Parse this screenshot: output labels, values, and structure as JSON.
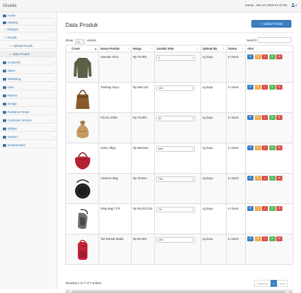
{
  "app": {
    "brand": "Gisella",
    "datetime": "Kamis , Mei 23 2019 21:47:06"
  },
  "sidebar": [
    {
      "label": "Home",
      "level": 1,
      "arrow": ""
    },
    {
      "label": "Katalog",
      "level": 1,
      "arrow": "⌄"
    },
    {
      "label": "Kategori",
      "level": 2,
      "arrow": "‹"
    },
    {
      "label": "Produk",
      "level": 2,
      "arrow": "⌄"
    },
    {
      "label": "Upload Produk",
      "level": 3,
      "arrow": ""
    },
    {
      "label": "Data Produk",
      "level": 3,
      "arrow": ""
    },
    {
      "label": "Customer",
      "level": 1,
      "arrow": "‹"
    },
    {
      "label": "Sales",
      "level": 1,
      "arrow": "‹"
    },
    {
      "label": "Marketing",
      "level": 1,
      "arrow": "‹"
    },
    {
      "label": "User",
      "level": 1,
      "arrow": "‹"
    },
    {
      "label": "Partner",
      "level": 1,
      "arrow": "‹"
    },
    {
      "label": "Design",
      "level": 1,
      "arrow": "‹"
    },
    {
      "label": "Kontak & Pesan",
      "level": 1,
      "arrow": "‹"
    },
    {
      "label": "Customer Service",
      "level": 1,
      "arrow": "‹"
    },
    {
      "label": "Widget",
      "level": 1,
      "arrow": "‹"
    },
    {
      "label": "System",
      "level": 1,
      "arrow": "‹"
    },
    {
      "label": "Dokumentasi",
      "level": 1,
      "arrow": ""
    }
  ],
  "page": {
    "title": "Data Produk",
    "upload_button": "Upload Produk"
  },
  "table_controls": {
    "show_label": "Show",
    "entries_value": "10",
    "entries_label": "entries",
    "search_label": "Search:",
    "search_value": ""
  },
  "columns": [
    "Cover",
    "Nama Produk",
    "Harga",
    "Jumlah Stok",
    "Upload By",
    "Status",
    "Aksi"
  ],
  "rows": [
    {
      "name": "Sweater Ohio",
      "price": "Rp 78.000",
      "stock": "4",
      "upload_by": "ng bayu",
      "status": "In Stock",
      "cover": "sweater"
    },
    {
      "name": "Totebag Onyo",
      "price": "Rp 865.222",
      "stock": "100",
      "upload_by": "ng bayu",
      "status": "In Stock",
      "cover": "tote"
    },
    {
      "name": "Pouch Jelliot",
      "price": "Rp 78.000",
      "stock": "90",
      "upload_by": "ng bayu",
      "status": "In Stock",
      "cover": "pouch"
    },
    {
      "name": "Hobo Ulbyy",
      "price": "Rp 666.664",
      "stock": "666",
      "upload_by": "ng bayu",
      "status": "In Stock",
      "cover": "hobo"
    },
    {
      "name": "Canteen Bag",
      "price": "Rp 78.522",
      "stock": "780",
      "upload_by": "ng bayu",
      "status": "In Stock",
      "cover": "canteen"
    },
    {
      "name": "Sling Bag TYO",
      "price": "Rp 98.022.222",
      "stock": "78",
      "upload_by": "ng bayu",
      "status": "In Stock",
      "cover": "sling"
    },
    {
      "name": "Tas Ransel Bakto",
      "price": "Rp 90.000",
      "stock": "149",
      "upload_by": "ng bayu",
      "status": "In Stock",
      "cover": "backpack"
    }
  ],
  "footer": {
    "info": "Showing 1 to 7 of 7 entries",
    "prev": "Previous",
    "page": "1",
    "next": "Next"
  }
}
